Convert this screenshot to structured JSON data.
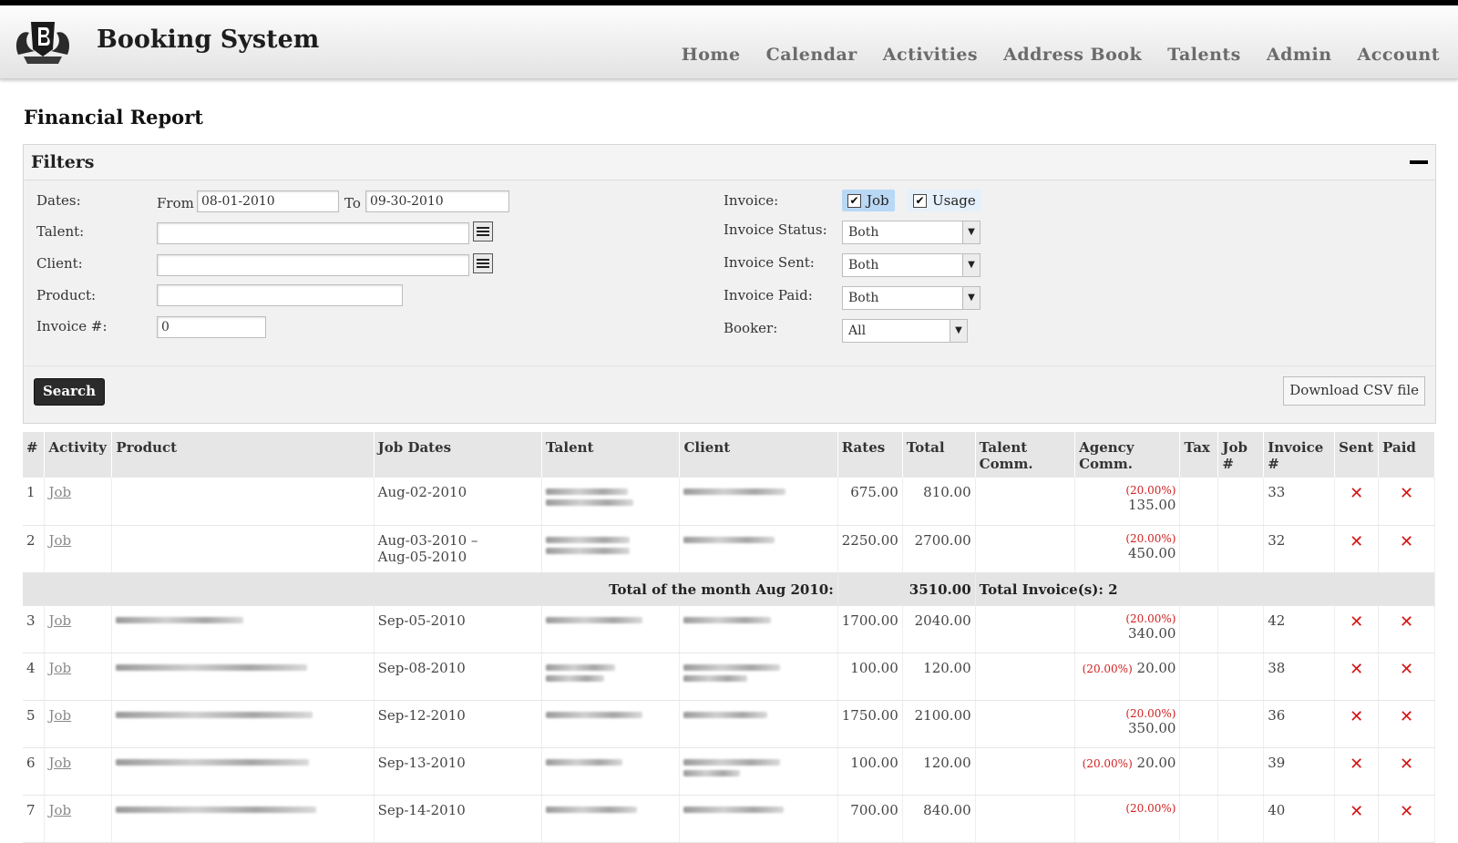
{
  "app": {
    "title": "Booking System",
    "nav": [
      "Home",
      "Calendar",
      "Activities",
      "Address Book",
      "Talents",
      "Admin",
      "Account"
    ]
  },
  "page": {
    "title": "Financial Report"
  },
  "filters": {
    "heading": "Filters",
    "dates_label": "Dates:",
    "from_label": "From",
    "from_value": "08-01-2010",
    "to_label": "To",
    "to_value": "09-30-2010",
    "talent_label": "Talent:",
    "talent_value": "",
    "client_label": "Client:",
    "client_value": "",
    "product_label": "Product:",
    "product_value": "",
    "invoice_no_label": "Invoice #:",
    "invoice_no_value": "0",
    "invoice_label": "Invoice:",
    "job_label": "Job",
    "job_checked": true,
    "usage_label": "Usage",
    "usage_checked": true,
    "invoice_status_label": "Invoice Status:",
    "invoice_status_value": "Both",
    "invoice_sent_label": "Invoice Sent:",
    "invoice_sent_value": "Both",
    "invoice_paid_label": "Invoice Paid:",
    "invoice_paid_value": "Both",
    "booker_label": "Booker:",
    "booker_value": "All",
    "search_label": "Search",
    "csv_label": "Download CSV file"
  },
  "table": {
    "headers": [
      "#",
      "Activity",
      "Product",
      "Job Dates",
      "Talent",
      "Client",
      "Rates",
      "Total",
      "Talent Comm.",
      "Agency Comm.",
      "Tax",
      "Job #",
      "Invoice #",
      "Sent",
      "Paid"
    ],
    "rows_a": [
      {
        "no": "1",
        "activity": "Job",
        "dates": "Aug-02-2010",
        "dates2": "",
        "rates": "675.00",
        "total": "810.00",
        "comm_pct": "(20.00%)",
        "comm": "135.00",
        "invoice": "33"
      },
      {
        "no": "2",
        "activity": "Job",
        "dates": "Aug-03-2010 –",
        "dates2": "Aug-05-2010",
        "rates": "2250.00",
        "total": "2700.00",
        "comm_pct": "(20.00%)",
        "comm": "450.00",
        "invoice": "32"
      }
    ],
    "month_total": {
      "label": "Total of the month Aug 2010:",
      "amount": "3510.00",
      "invoices": "Total Invoice(s): 2"
    },
    "rows_b": [
      {
        "no": "3",
        "activity": "Job",
        "dates": "Sep-05-2010",
        "rates": "1700.00",
        "total": "2040.00",
        "comm_pct": "(20.00%)",
        "comm": "340.00",
        "invoice": "42"
      },
      {
        "no": "4",
        "activity": "Job",
        "dates": "Sep-08-2010",
        "rates": "100.00",
        "total": "120.00",
        "comm_pct": "(20.00%)",
        "comm": "20.00",
        "invoice": "38"
      },
      {
        "no": "5",
        "activity": "Job",
        "dates": "Sep-12-2010",
        "rates": "1750.00",
        "total": "2100.00",
        "comm_pct": "(20.00%)",
        "comm": "350.00",
        "invoice": "36"
      },
      {
        "no": "6",
        "activity": "Job",
        "dates": "Sep-13-2010",
        "rates": "100.00",
        "total": "120.00",
        "comm_pct": "(20.00%)",
        "comm": "20.00",
        "invoice": "39"
      },
      {
        "no": "7",
        "activity": "Job",
        "dates": "Sep-14-2010",
        "rates": "700.00",
        "total": "840.00",
        "comm_pct": "(20.00%)",
        "comm": "",
        "invoice": "40"
      }
    ],
    "sent_mark": "✕",
    "paid_mark": "✕"
  },
  "colors": {
    "accent_red": "#d41515",
    "header_bg": "#e6e6e6"
  }
}
